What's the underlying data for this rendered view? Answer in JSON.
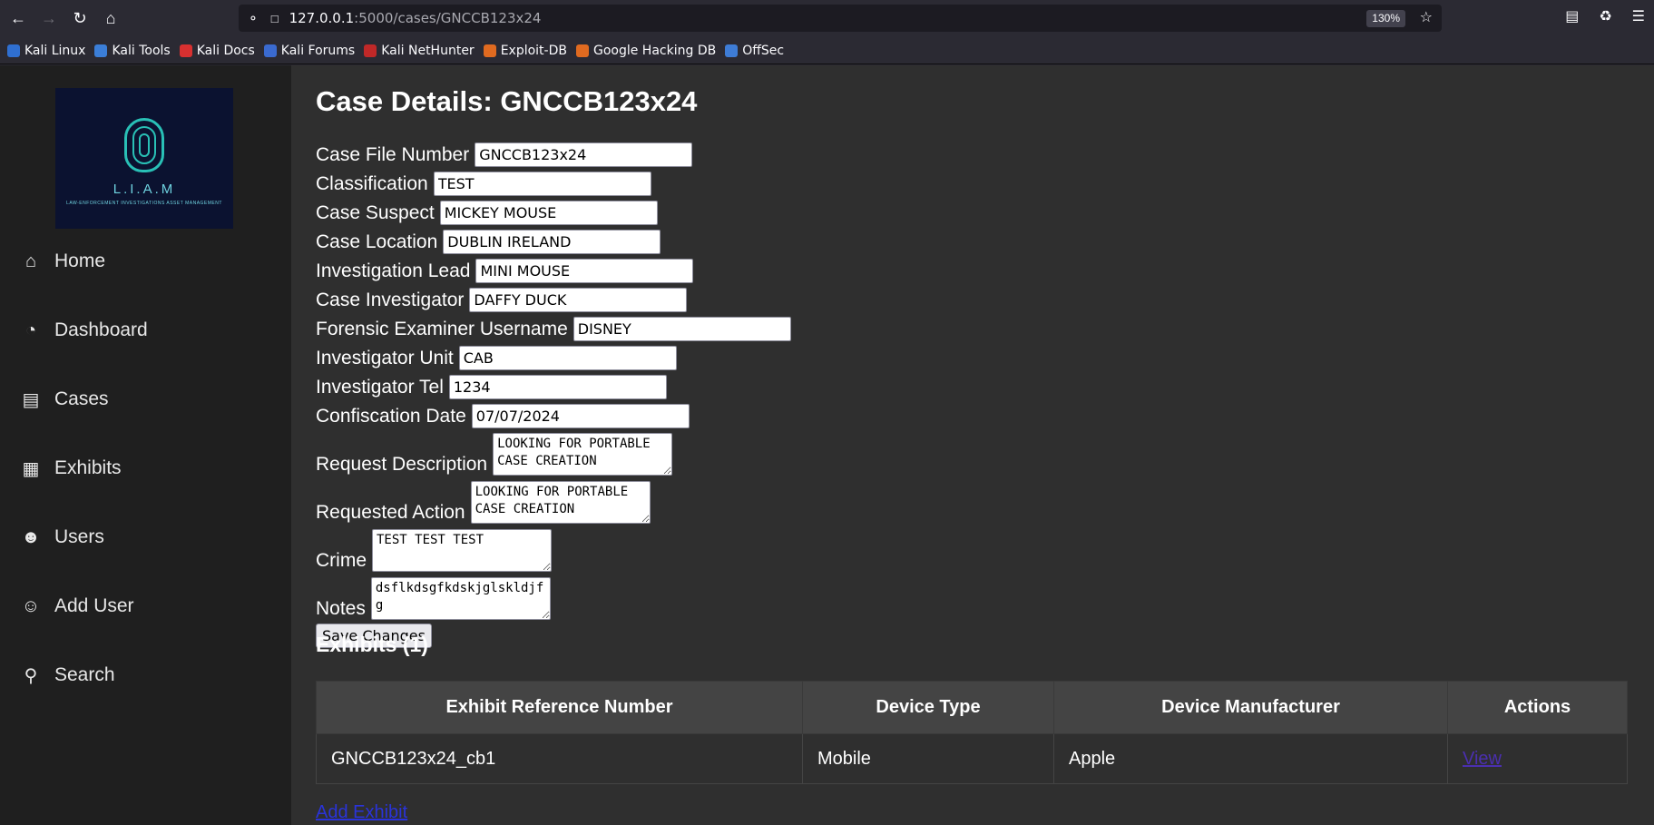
{
  "browser": {
    "url_host": "127.0.0.1",
    "url_rest": ":5000/cases/GNCCB123x24",
    "zoom": "130%",
    "bookmarks": [
      "Kali Linux",
      "Kali Tools",
      "Kali Docs",
      "Kali Forums",
      "Kali NetHunter",
      "Exploit-DB",
      "Google Hacking DB",
      "OffSec"
    ]
  },
  "sidebar": {
    "logo_brand": "L.I.A.M",
    "logo_tagline": "LAW-ENFORCEMENT INVESTIGATIONS ASSET MANAGEMENT",
    "items": [
      {
        "label": "Home",
        "icon": "home-icon"
      },
      {
        "label": "Dashboard",
        "icon": "gauge-icon"
      },
      {
        "label": "Cases",
        "icon": "briefcase-icon"
      },
      {
        "label": "Exhibits",
        "icon": "box-icon"
      },
      {
        "label": "Users",
        "icon": "users-icon"
      },
      {
        "label": "Add User",
        "icon": "add-user-icon"
      },
      {
        "label": "Search",
        "icon": "search-icon"
      }
    ]
  },
  "main": {
    "title": "Case Details: GNCCB123x24",
    "fields": [
      {
        "label": "Case File Number",
        "value": "GNCCB123x24"
      },
      {
        "label": "Classification",
        "value": "TEST"
      },
      {
        "label": "Case Suspect",
        "value": "MICKEY MOUSE"
      },
      {
        "label": "Case Location",
        "value": "DUBLIN IRELAND"
      },
      {
        "label": "Investigation Lead",
        "value": "MINI MOUSE"
      },
      {
        "label": "Case Investigator",
        "value": "DAFFY DUCK"
      },
      {
        "label": "Forensic Examiner Username",
        "value": "DISNEY"
      },
      {
        "label": "Investigator Unit",
        "value": "CAB"
      },
      {
        "label": "Investigator Tel",
        "value": "1234"
      },
      {
        "label": "Confiscation Date",
        "value": "07/07/2024"
      }
    ],
    "textareas": [
      {
        "label": "Request Description",
        "value": "LOOKING FOR PORTABLE CASE CREATION"
      },
      {
        "label": "Requested Action",
        "value": "LOOKING FOR PORTABLE CASE CREATION"
      },
      {
        "label": "Crime",
        "value": "TEST TEST TEST"
      },
      {
        "label": "Notes",
        "value": "dsflkdsgfkdskjglskldjfg"
      }
    ],
    "save_label": "Save Changes",
    "exhibits_heading": "Exhibits (1)",
    "table": {
      "headers": [
        "Exhibit Reference Number",
        "Device Type",
        "Device Manufacturer",
        "Actions"
      ],
      "rows": [
        {
          "ref": "GNCCB123x24_cb1",
          "type": "Mobile",
          "manufacturer": "Apple",
          "action": "View"
        }
      ]
    },
    "add_exhibit_label": "Add Exhibit"
  }
}
